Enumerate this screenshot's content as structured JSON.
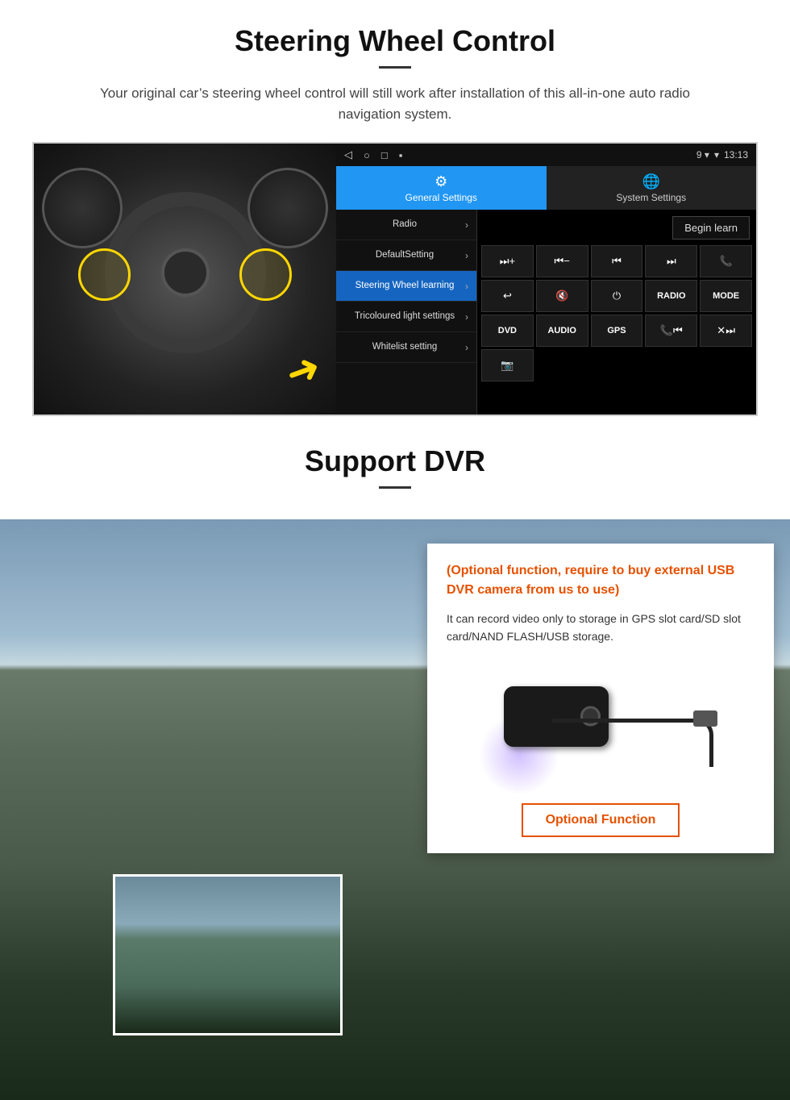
{
  "steering_section": {
    "title": "Steering Wheel Control",
    "subtitle": "Your original car’s steering wheel control will still work after installation of this all-in-one auto radio navigation system.",
    "android_ui": {
      "status_bar": {
        "nav_icons": [
          "◁",
          "○",
          "□",
          "■"
        ],
        "time": "13:13",
        "signal": "9 ▾"
      },
      "tabs": [
        {
          "label": "General Settings",
          "icon": "⚙",
          "active": true
        },
        {
          "label": "System Settings",
          "icon": "🌐",
          "active": false
        }
      ],
      "menu_items": [
        {
          "label": "Radio",
          "active": false
        },
        {
          "label": "DefaultSetting",
          "active": false
        },
        {
          "label": "Steering Wheel learning",
          "active": true
        },
        {
          "label": "Tricoloured light settings",
          "active": false
        },
        {
          "label": "Whitelist setting",
          "active": false
        }
      ],
      "begin_learn_label": "Begin learn",
      "control_buttons": [
        "❙+",
        "❙−",
        "⏮",
        "⏭",
        "☎",
        "⮌",
        "❙×",
        "⏻",
        "RADIO",
        "MODE",
        "DVD",
        "AUDIO",
        "GPS",
        "☎⏮",
        "×⏭"
      ]
    }
  },
  "dvr_section": {
    "title": "Support DVR",
    "optional_text": "(Optional function, require to buy external USB DVR camera from us to use)",
    "description": "It can record video only to storage in GPS slot card/SD slot card/NAND FLASH/USB storage.",
    "optional_function_label": "Optional Function"
  }
}
